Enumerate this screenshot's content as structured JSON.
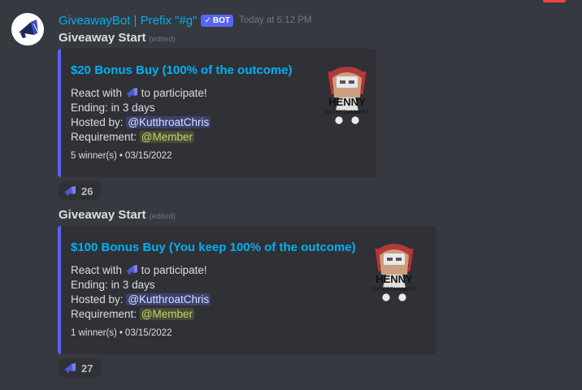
{
  "author": {
    "name": "GiveawayBot | Prefix \"#g\"",
    "bot_tag": "BOT",
    "bot_check": "✓",
    "timestamp": "Today at 6:12 PM"
  },
  "messages": [
    {
      "title": "Giveaway Start",
      "edited": "(edited)",
      "embed": {
        "title": "$20 Bonus Buy (100% of the outcome)",
        "react_prefix": "React with",
        "react_suffix": "to participate!",
        "ending_label": "Ending:",
        "ending_value": "in 3 days",
        "hosted_label": "Hosted by:",
        "host": "@KutthroatChris",
        "requirement_label": "Requirement:",
        "requirement": "@Member",
        "winners": "5 winner(s)",
        "bullet": "•",
        "date": "03/15/2022",
        "thumbnail_text": "HENNY",
        "thumbnail_subtext": "ENTERTAINMENT"
      },
      "reaction": {
        "emoji": "megaphone-emoji",
        "count": "26"
      }
    },
    {
      "title": "Giveaway Start",
      "edited": "(edited)",
      "embed": {
        "title": "$100 Bonus Buy (You keep 100% of the outcome)",
        "react_prefix": "React with",
        "react_suffix": "to participate!",
        "ending_label": "Ending:",
        "ending_value": "in 3 days",
        "hosted_label": "Hosted by:",
        "host": "@KutthroatChris",
        "requirement_label": "Requirement:",
        "requirement": "@Member",
        "winners": "1 winner(s)",
        "bullet": "•",
        "date": "03/15/2022",
        "thumbnail_text": "HENNY",
        "thumbnail_subtext": "ENTERTAINMENT"
      },
      "reaction": {
        "emoji": "megaphone-emoji",
        "count": "27"
      }
    }
  ],
  "colors": {
    "background": "#36393f",
    "embed_bg": "#2f3136",
    "embed_accent": "#5865f2",
    "link_blue": "#00b0f4",
    "text": "#dcddde",
    "muted": "#72767d"
  }
}
